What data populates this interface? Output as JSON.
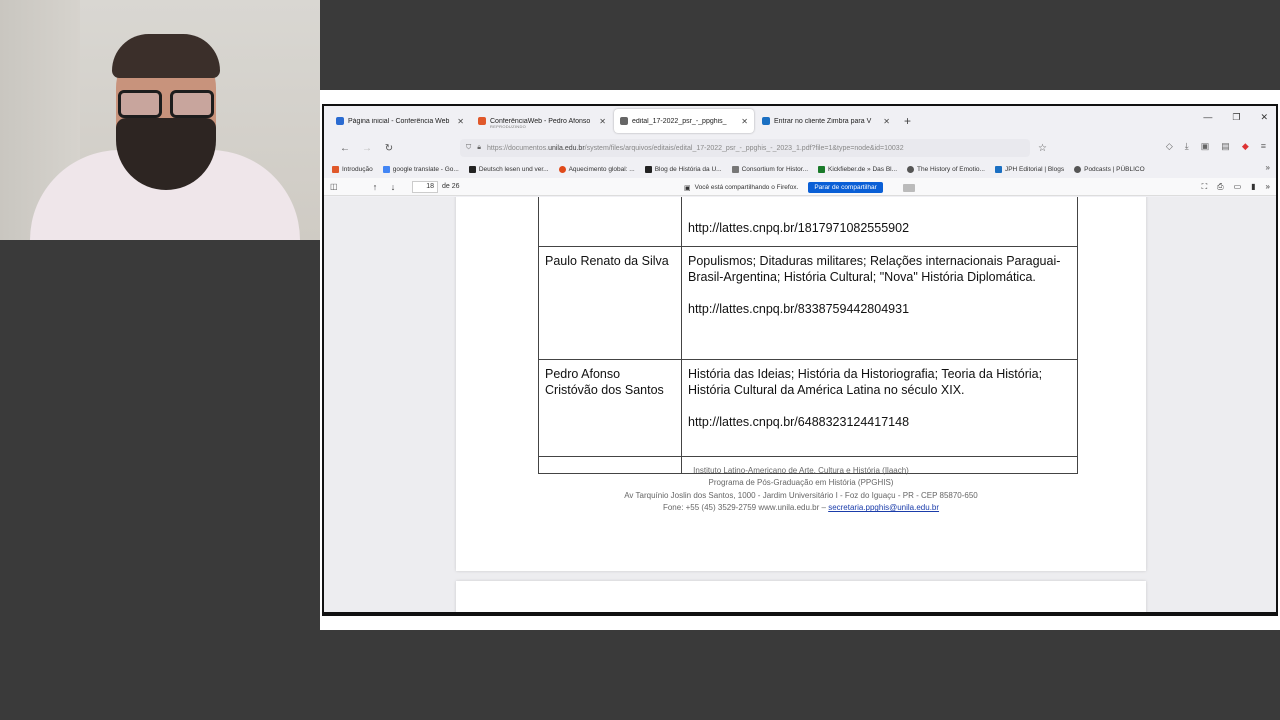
{
  "browser": {
    "tabs": [
      {
        "label": "Página inicial - Conferência Web",
        "favcolor": "#2a6bd1",
        "active": false
      },
      {
        "label": "ConferênciaWeb - Pedro Afonso",
        "sub": "REPRODUZINDO",
        "favcolor": "#e0582a",
        "active": false
      },
      {
        "label": "edital_17-2022_psr_-_ppghis_",
        "favcolor": "#666666",
        "active": true
      },
      {
        "label": "Entrar no cliente Zimbra para V",
        "favcolor": "#1a6fc2",
        "active": false
      }
    ],
    "url_prefix": "https://documentos.",
    "url_host": "unila.edu.br",
    "url_rest": "/system/files/arquivos/editais/edital_17-2022_psr_-_ppghis_-_2023_1.pdf?file=1&type=node&id=10032",
    "bookmarks": [
      {
        "label": "Introdução",
        "favcolor": "#e0582a"
      },
      {
        "label": "google translate - Go...",
        "favcolor": "#4285f4"
      },
      {
        "label": "Deutsch lesen und ver...",
        "favcolor": "#222222"
      },
      {
        "label": "Aquecimento global: ...",
        "favcolor": "#e04a1a"
      },
      {
        "label": "Blog de História da U...",
        "favcolor": "#222222"
      },
      {
        "label": "Consortium for Histor...",
        "favcolor": "#777777"
      },
      {
        "label": "Kickfieber.de » Das Bl...",
        "favcolor": "#1a7a2a"
      },
      {
        "label": "The History of Emotio...",
        "favcolor": "#555555"
      },
      {
        "label": "JPH Editorial | Blogs",
        "favcolor": "#1a6fc2"
      },
      {
        "label": "Podcasts | PÚBLICO",
        "favcolor": "#555555"
      }
    ]
  },
  "pdf": {
    "page_current": "18",
    "page_total": "de 26",
    "share_note": "Você está compartilhando o Firefox.",
    "stop_share": "Parar de compartilhar",
    "table": [
      {
        "name": "",
        "text": "",
        "link": "http://lattes.cnpq.br/1817971082555902"
      },
      {
        "name": "Paulo Renato da Silva",
        "text": "Populismos; Ditaduras militares; Relações internacionais Paraguai-Brasil-Argentina; História Cultural; \"Nova\" História Diplomática.",
        "link": "http://lattes.cnpq.br/8338759442804931"
      },
      {
        "name": "Pedro Afonso Cristóvão dos Santos",
        "text": "História das Ideias; História da Historiografia; Teoria da História; História Cultural da América Latina no século XIX.",
        "link": "http://lattes.cnpq.br/6488323124417148"
      }
    ],
    "footer": {
      "line1": "Instituto Latino-Americano de Arte, Cultura e História (Ilaach)",
      "line2": "Programa de Pós-Graduação em História (PPGHIS)",
      "line3": "Av Tarquínio Joslin dos Santos, 1000 - Jardim Universitário I - Foz do Iguaçu - PR - CEP 85870-650",
      "line4": "Fone: +55 (45) 3529-2759 www.unila.edu.br –",
      "email": "secretaria.ppghis@unila.edu.br"
    }
  }
}
